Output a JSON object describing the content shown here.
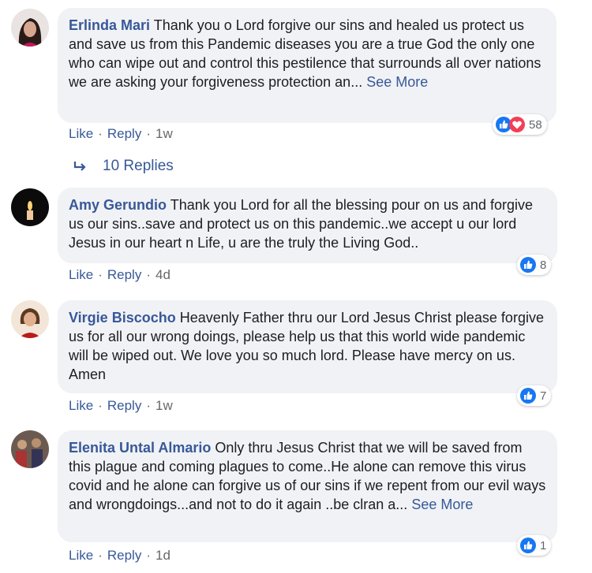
{
  "comments": [
    {
      "author": "Erlinda Mari",
      "text": "Thank you o Lord forgive our sins and healed us protect us and save us from this Pandemic diseases you are a true God the only one who can wipe out and control this pestilence that surrounds all over nations we are asking your forgiveness protection an...",
      "see_more": "See More",
      "like": "Like",
      "reply": "Reply",
      "time": "1w",
      "reactions": {
        "count": "58",
        "icons": [
          "like-icon",
          "love-icon"
        ]
      }
    },
    {
      "author": "Amy Gerundio",
      "text": "Thank you Lord for all the blessing pour on us and forgive us our sins..save and protect us on this pandemic..we accept u our lord Jesus in our heart n Life, u are the truly the Living God..",
      "like": "Like",
      "reply": "Reply",
      "time": "4d",
      "reactions": {
        "count": "8",
        "icons": [
          "like-icon"
        ]
      }
    },
    {
      "author": "Virgie Biscocho",
      "text": "Heavenly Father thru our Lord Jesus Christ please forgive us for all our wrong doings, please help us that this world wide pandemic will be wiped out. We love you so much lord. Please have mercy on us. Amen",
      "like": "Like",
      "reply": "Reply",
      "time": "1w",
      "reactions": {
        "count": "7",
        "icons": [
          "like-icon"
        ]
      }
    },
    {
      "author": "Elenita Untal Almario",
      "text": "Only thru Jesus Christ that we will be saved from this plague and coming plagues to come..He alone can remove this virus covid and he alone can forgive us of our sins if we repent from our evil ways and wrongdoings...and not to do it again ..be clran a...",
      "see_more": "See More",
      "like": "Like",
      "reply": "Reply",
      "time": "1d",
      "reactions": {
        "count": "1",
        "icons": [
          "like-icon"
        ]
      }
    }
  ],
  "replies_link": "10 Replies",
  "colors": {
    "link": "#385898",
    "bubble": "#f0f2f5",
    "like_blue": "#1877f2",
    "love_red": "#f33e58"
  }
}
